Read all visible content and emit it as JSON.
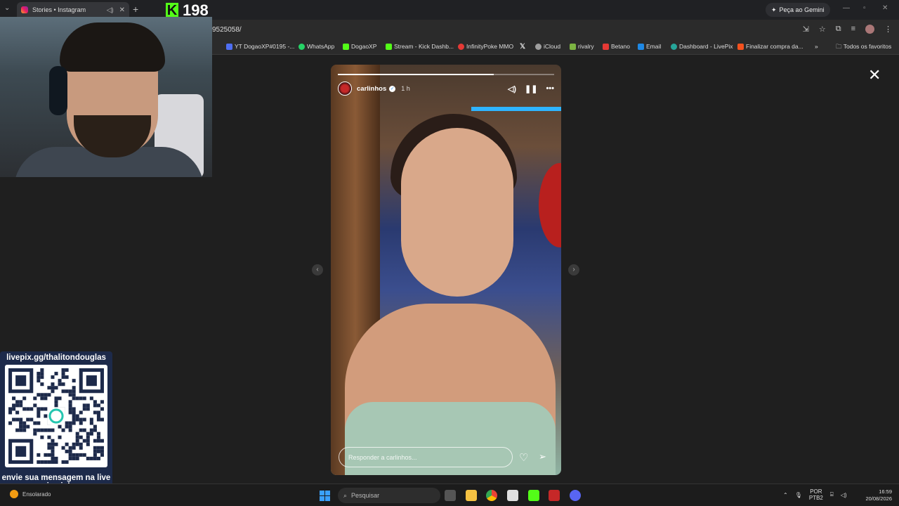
{
  "browser": {
    "tab_title": "Stories • Instagram",
    "url": "9525058/",
    "gemini_label": "Peça ao Gemini",
    "bookmarks": [
      {
        "label": "YT DogaoXP#0195 -...",
        "color": "#4e6ef2"
      },
      {
        "label": "WhatsApp",
        "color": "#25d366"
      },
      {
        "label": "DogaoXP",
        "color": "#53fc18"
      },
      {
        "label": "Stream - Kick Dashb...",
        "color": "#53fc18"
      },
      {
        "label": "InfinityPoke MMO",
        "color": "#e53935"
      },
      {
        "label": "",
        "color": "#ffffff"
      },
      {
        "label": "iCloud",
        "color": "#9e9e9e"
      },
      {
        "label": "rivalry",
        "color": "#7cb342"
      },
      {
        "label": "Betano",
        "color": "#e53935"
      },
      {
        "label": "Email",
        "color": "#1e88e5"
      },
      {
        "label": "Dashboard - LivePix",
        "color": "#26a69a"
      },
      {
        "label": "Finalizar compra da...",
        "color": "#f4511e"
      }
    ],
    "bookmarks_more": "»",
    "all_bookmarks": "Todos os favoritos"
  },
  "kick_overlay": {
    "logo": "K",
    "viewer_count": "198"
  },
  "story": {
    "username": "carlinhos",
    "time": "1 h",
    "progress": 0.72,
    "reply_placeholder": "Responder a carlinhos...",
    "prev_arrow": "‹",
    "next_arrow": "›",
    "close": "✕"
  },
  "qr_overlay": {
    "title": "livepix.gg/thalitondouglas",
    "cta": "envie sua mensagem na live via pix!"
  },
  "taskbar": {
    "weather": "Ensolarado",
    "search_placeholder": "Pesquisar",
    "lang_top": "POR",
    "lang_bottom": "PTB2",
    "time": "16:59",
    "date": "20/08/2026"
  },
  "icons": [
    "instagram-icon",
    "speaker-icon",
    "close-icon",
    "plus-icon",
    "mute-icon",
    "pause-icon",
    "more-icon",
    "heart-icon",
    "send-icon",
    "search-icon",
    "windows-icon"
  ]
}
